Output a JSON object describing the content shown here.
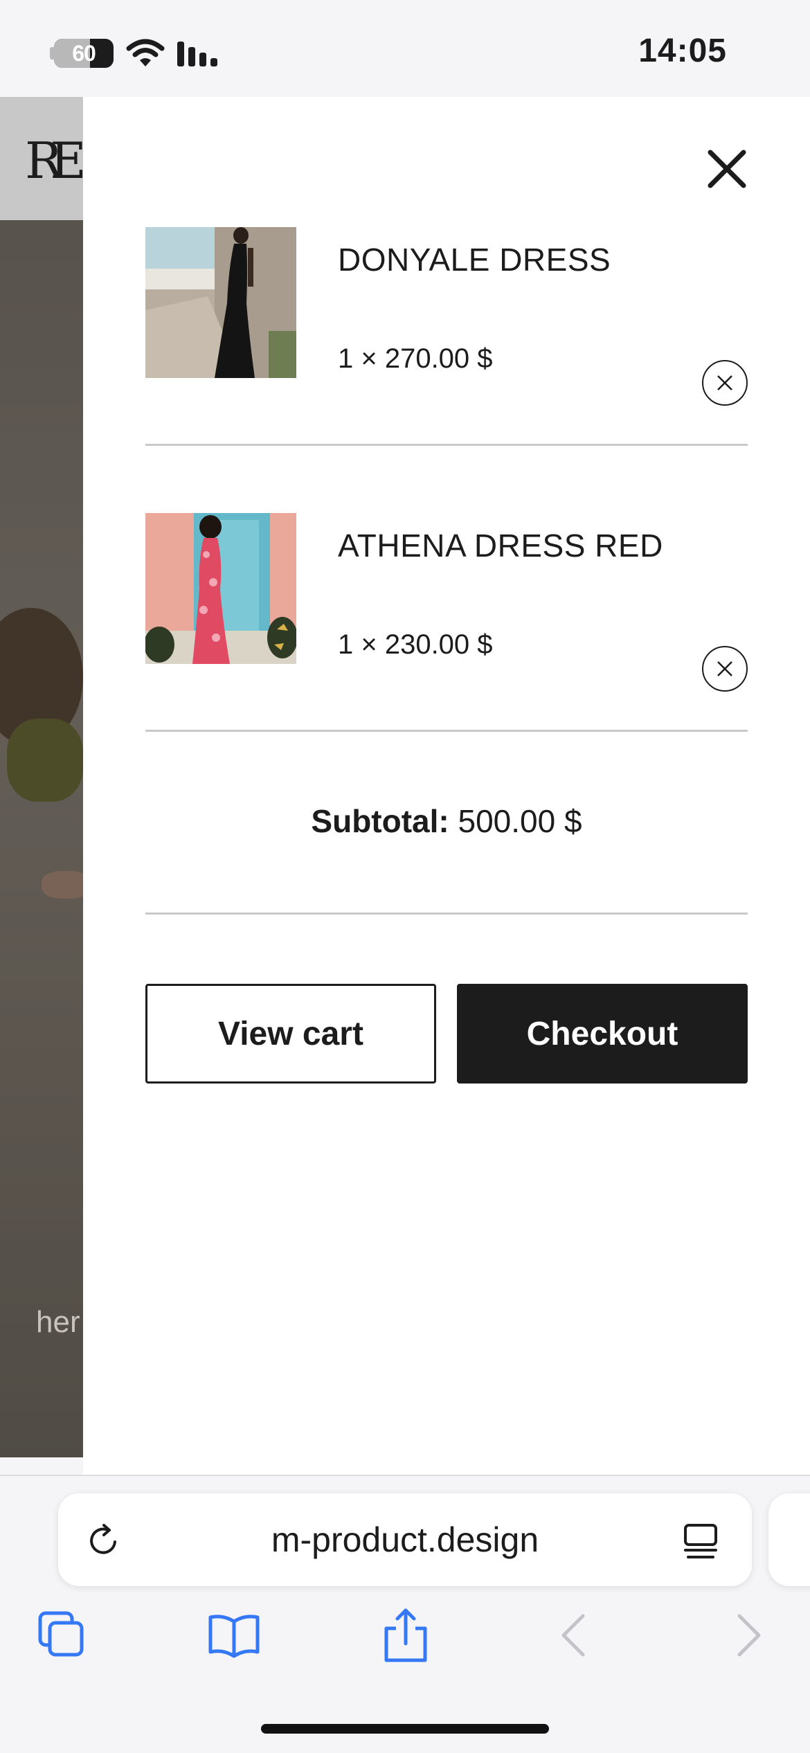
{
  "status_bar": {
    "battery": "60",
    "time": "14:05",
    "icons": [
      "battery-icon",
      "wifi-icon",
      "signal-icon"
    ]
  },
  "background_page": {
    "logo": "RE",
    "hero_text": "her"
  },
  "cart": {
    "items": [
      {
        "name": "DONYALE DRESS",
        "price_line": "1 × 270.00 $",
        "thumbnail": "donyale-dress-thumbnail"
      },
      {
        "name": "ATHENA DRESS RED",
        "price_line": "1 × 230.00 $",
        "thumbnail": "athena-dress-red-thumbnail"
      }
    ],
    "subtotal_label": "Subtotal:",
    "subtotal_value": "500.00 $",
    "view_cart_label": "View cart",
    "checkout_label": "Checkout"
  },
  "browser": {
    "url": "m-product.design",
    "toolbar_icons": [
      "tabs-icon",
      "bookmarks-icon",
      "share-icon",
      "back-icon",
      "forward-icon"
    ]
  },
  "colors": {
    "text": "#1c1c1c",
    "divider": "#c9c9c9",
    "safari_blue": "#3478f6",
    "disabled_gray": "#c4c4c8"
  }
}
